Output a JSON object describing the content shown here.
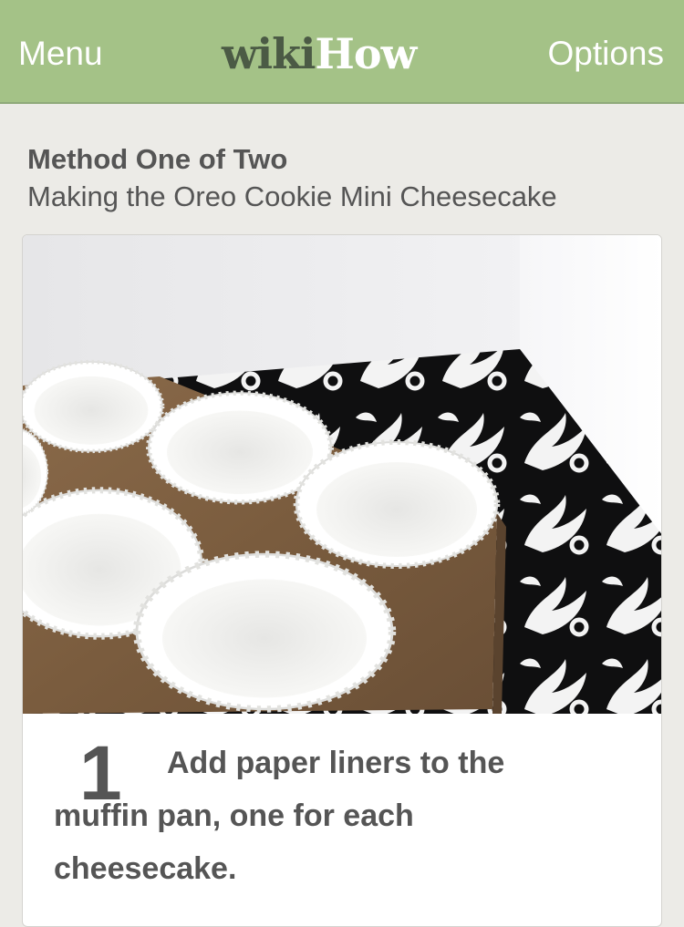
{
  "header": {
    "menu_label": "Menu",
    "logo_wiki": "wiki",
    "logo_how": "How",
    "options_label": "Options",
    "background_color": "#a4c287"
  },
  "method": {
    "heading": "Method One of Two",
    "subheading": "Making the Oreo Cookie Mini Cheesecake"
  },
  "step": {
    "number": "1",
    "text": "Add paper liners to the muffin pan, one for each cheesecake.",
    "image_subject": "muffin pan with white paper liners on black and white damask paper"
  }
}
